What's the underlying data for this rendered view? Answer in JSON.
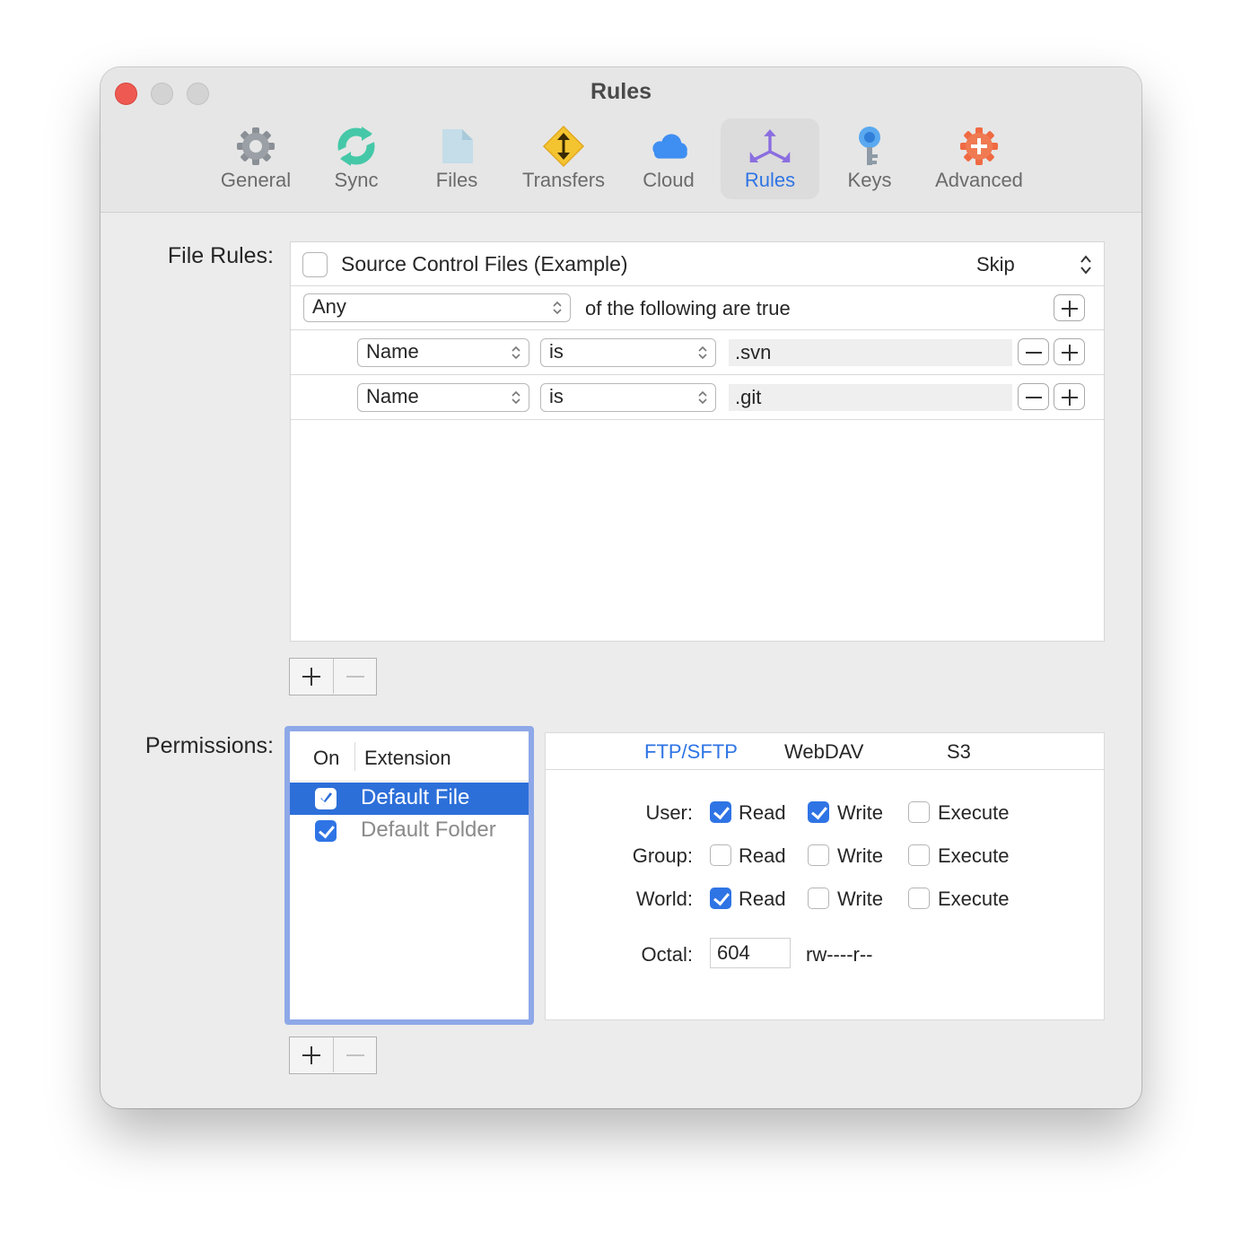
{
  "window": {
    "title": "Rules"
  },
  "toolbar": {
    "tabs": [
      {
        "label": "General",
        "icon": "gear-icon"
      },
      {
        "label": "Sync",
        "icon": "sync-icon"
      },
      {
        "label": "Files",
        "icon": "file-icon"
      },
      {
        "label": "Transfers",
        "icon": "transfers-icon"
      },
      {
        "label": "Cloud",
        "icon": "cloud-icon"
      },
      {
        "label": "Rules",
        "icon": "rules-arrows-icon",
        "active": true
      },
      {
        "label": "Keys",
        "icon": "key-icon"
      },
      {
        "label": "Advanced",
        "icon": "advanced-gear-icon"
      }
    ]
  },
  "file_rules": {
    "label": "File Rules:",
    "rule": {
      "name": "Source Control Files (Example)",
      "enabled": false,
      "action": "Skip",
      "match": "Any",
      "match_suffix": "of the following are true",
      "conditions": [
        {
          "field": "Name",
          "operator": "is",
          "value": ".svn"
        },
        {
          "field": "Name",
          "operator": "is",
          "value": ".git"
        }
      ]
    }
  },
  "permissions": {
    "label": "Permissions:",
    "list_headers": {
      "on": "On",
      "extension": "Extension"
    },
    "items": [
      {
        "label": "Default File",
        "on": true,
        "selected": true
      },
      {
        "label": "Default Folder",
        "on": true,
        "selected": false
      }
    ],
    "tabs": [
      "FTP/SFTP",
      "WebDAV",
      "S3"
    ],
    "active_tab": "FTP/SFTP",
    "rows": [
      {
        "label": "User:",
        "read": true,
        "write": true,
        "execute": false
      },
      {
        "label": "Group:",
        "read": false,
        "write": false,
        "execute": false
      },
      {
        "label": "World:",
        "read": true,
        "write": false,
        "execute": false
      }
    ],
    "col_labels": {
      "read": "Read",
      "write": "Write",
      "execute": "Execute"
    },
    "octal_label": "Octal:",
    "octal_value": "604",
    "symbolic": "rw----r--"
  },
  "colors": {
    "accent": "#2f74e5",
    "selection": "#2d6fd9",
    "close": "#ee5a52"
  }
}
